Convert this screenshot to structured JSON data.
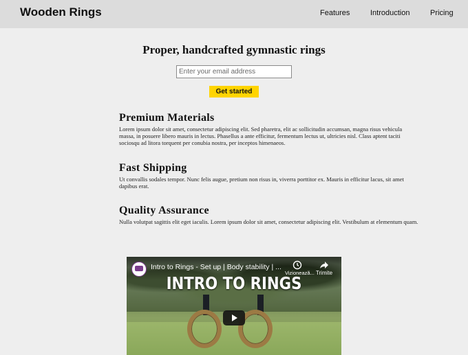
{
  "header": {
    "logo": "Wooden Rings",
    "nav": [
      {
        "label": "Features"
      },
      {
        "label": "Introduction"
      },
      {
        "label": "Pricing"
      }
    ]
  },
  "hero": {
    "title": "Proper, handcrafted gymnastic rings",
    "email_placeholder": "Enter your email address",
    "cta_label": "Get started"
  },
  "features": [
    {
      "title": "Premium Materials",
      "text": "Lorem ipsum dolor sit amet, consectetur adipiscing elit. Sed pharetra, elit ac sollicitudin accumsan, magna risus vehicula massa, in posuere libero mauris in lectus. Phasellus a ante efficitur, fermentum lectus ut, ultricies nisl. Class aptent taciti sociosqu ad litora torquent per conubia nostra, per inceptos himenaeos."
    },
    {
      "title": "Fast Shipping",
      "text": "Ut convallis sodales tempor. Nunc felis augue, pretium non risus in, viverra porttitor ex. Mauris in efficitur lacus, sit amet dapibus erat."
    },
    {
      "title": "Quality Assurance",
      "text": "Nulla volutpat sagittis elit eget iaculis. Lorem ipsum dolor sit amet, consectetur adipiscing elit. Vestibulum at elementum quam."
    }
  ],
  "video": {
    "title": "Intro to Rings - Set up | Body stability | ...",
    "overlay_text": "INTRO TO RINGS",
    "watch_later_label": "Vizionează...",
    "share_label": "Trimite",
    "icons": {
      "avatar": "channel-avatar",
      "watch_later": "clock-icon",
      "share": "share-arrow-icon",
      "play": "play-icon"
    }
  },
  "colors": {
    "header_bg": "#dcdcdc",
    "page_bg": "#eeeeee",
    "cta_bg": "#ffd400"
  }
}
